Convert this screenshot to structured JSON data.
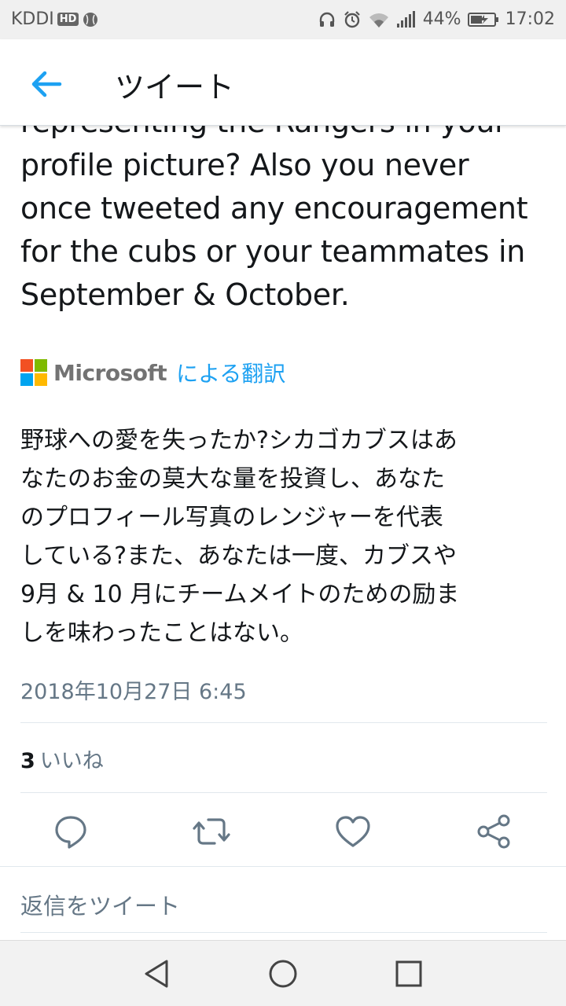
{
  "status_bar": {
    "carrier": "KDDI",
    "hd_badge": "HD",
    "battery_percent": "44%",
    "time": "17:02",
    "icons": [
      "baseball-icon",
      "headphones-icon",
      "alarm-icon",
      "wifi-icon",
      "signal-icon",
      "battery-charging-icon"
    ]
  },
  "header": {
    "title": "ツイート",
    "back_icon": "arrow-left-icon",
    "accent_color": "#1da1f2"
  },
  "tweet": {
    "original_lines": [
      "representing the Rangers in your",
      "profile picture? Also you never",
      "once tweeted any encouragement",
      "for the cubs or your teammates in",
      "September & October."
    ],
    "translation_provider": "Microsoft",
    "translation_label": "による翻訳",
    "translated_lines": [
      "野球への愛を失ったか?シカゴカブスはあ",
      "なたのお金の莫大な量を投資し、あなた",
      "のプロフィール写真のレンジャーを代表",
      "している?また、あなたは一度、カブスや",
      "9月 & 10 月にチームメイトのための励ま",
      "しを味わったことはない。"
    ],
    "timestamp": "2018年10月27日 6:45",
    "likes_count": "3",
    "likes_label": "いいね"
  },
  "actions": [
    "reply-icon",
    "retweet-icon",
    "like-heart-icon",
    "share-icon"
  ],
  "reply_placeholder": "返信をツイート",
  "nav": [
    "back-triangle-icon",
    "home-circle-icon",
    "recents-square-icon"
  ]
}
